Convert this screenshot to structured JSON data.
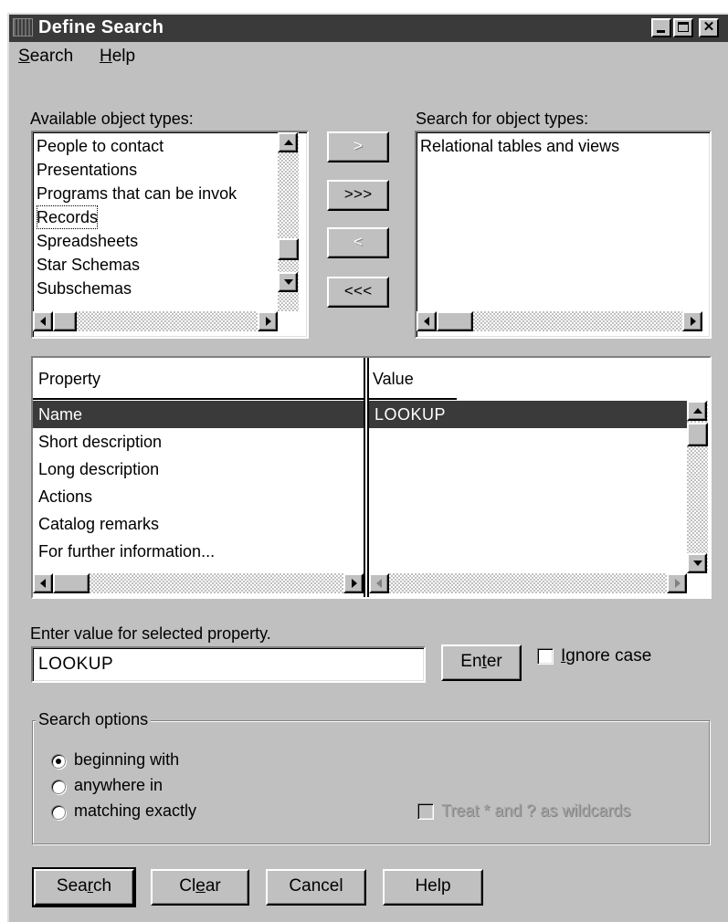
{
  "window": {
    "title": "Define Search"
  },
  "menu": {
    "search_pre": "",
    "search_u": "S",
    "search_post": "earch",
    "help_u": "H",
    "help_post": "elp"
  },
  "available": {
    "label": "Available object types:",
    "items": [
      "People to contact",
      "Presentations",
      "Programs that can be invok",
      "Records",
      "Spreadsheets",
      "Star Schemas",
      "Subschemas"
    ],
    "focused_index": 3
  },
  "selected_types": {
    "label": "Search for object types:",
    "items": [
      "Relational tables and views"
    ]
  },
  "transfer": {
    "add_one": ">",
    "add_all": ">>>",
    "remove_one": "<",
    "remove_all": "<<<"
  },
  "properties": {
    "col_property": "Property",
    "col_value": "Value",
    "rows": [
      "Name",
      "Short description",
      "Long description",
      "Actions",
      "Catalog remarks",
      "For further information..."
    ],
    "values": [
      "LOOKUP"
    ],
    "selected_index": 0
  },
  "entry": {
    "label": "Enter value for selected property.",
    "value": "LOOKUP",
    "enter_pre": "En",
    "enter_u": "t",
    "enter_post": "er",
    "ignore_u": "I",
    "ignore_post": "gnore case"
  },
  "options": {
    "group_label": "Search options",
    "radios": [
      "beginning with",
      "anywhere in",
      "matching exactly"
    ],
    "selected_radio": 0,
    "wildcards_label": "Treat * and ? as wildcards"
  },
  "buttons": {
    "search_pre": "Sea",
    "search_u": "r",
    "search_post": "ch",
    "clear_pre": "Cl",
    "clear_u": "e",
    "clear_post": "ar",
    "cancel": "Cancel",
    "help": "Help"
  }
}
